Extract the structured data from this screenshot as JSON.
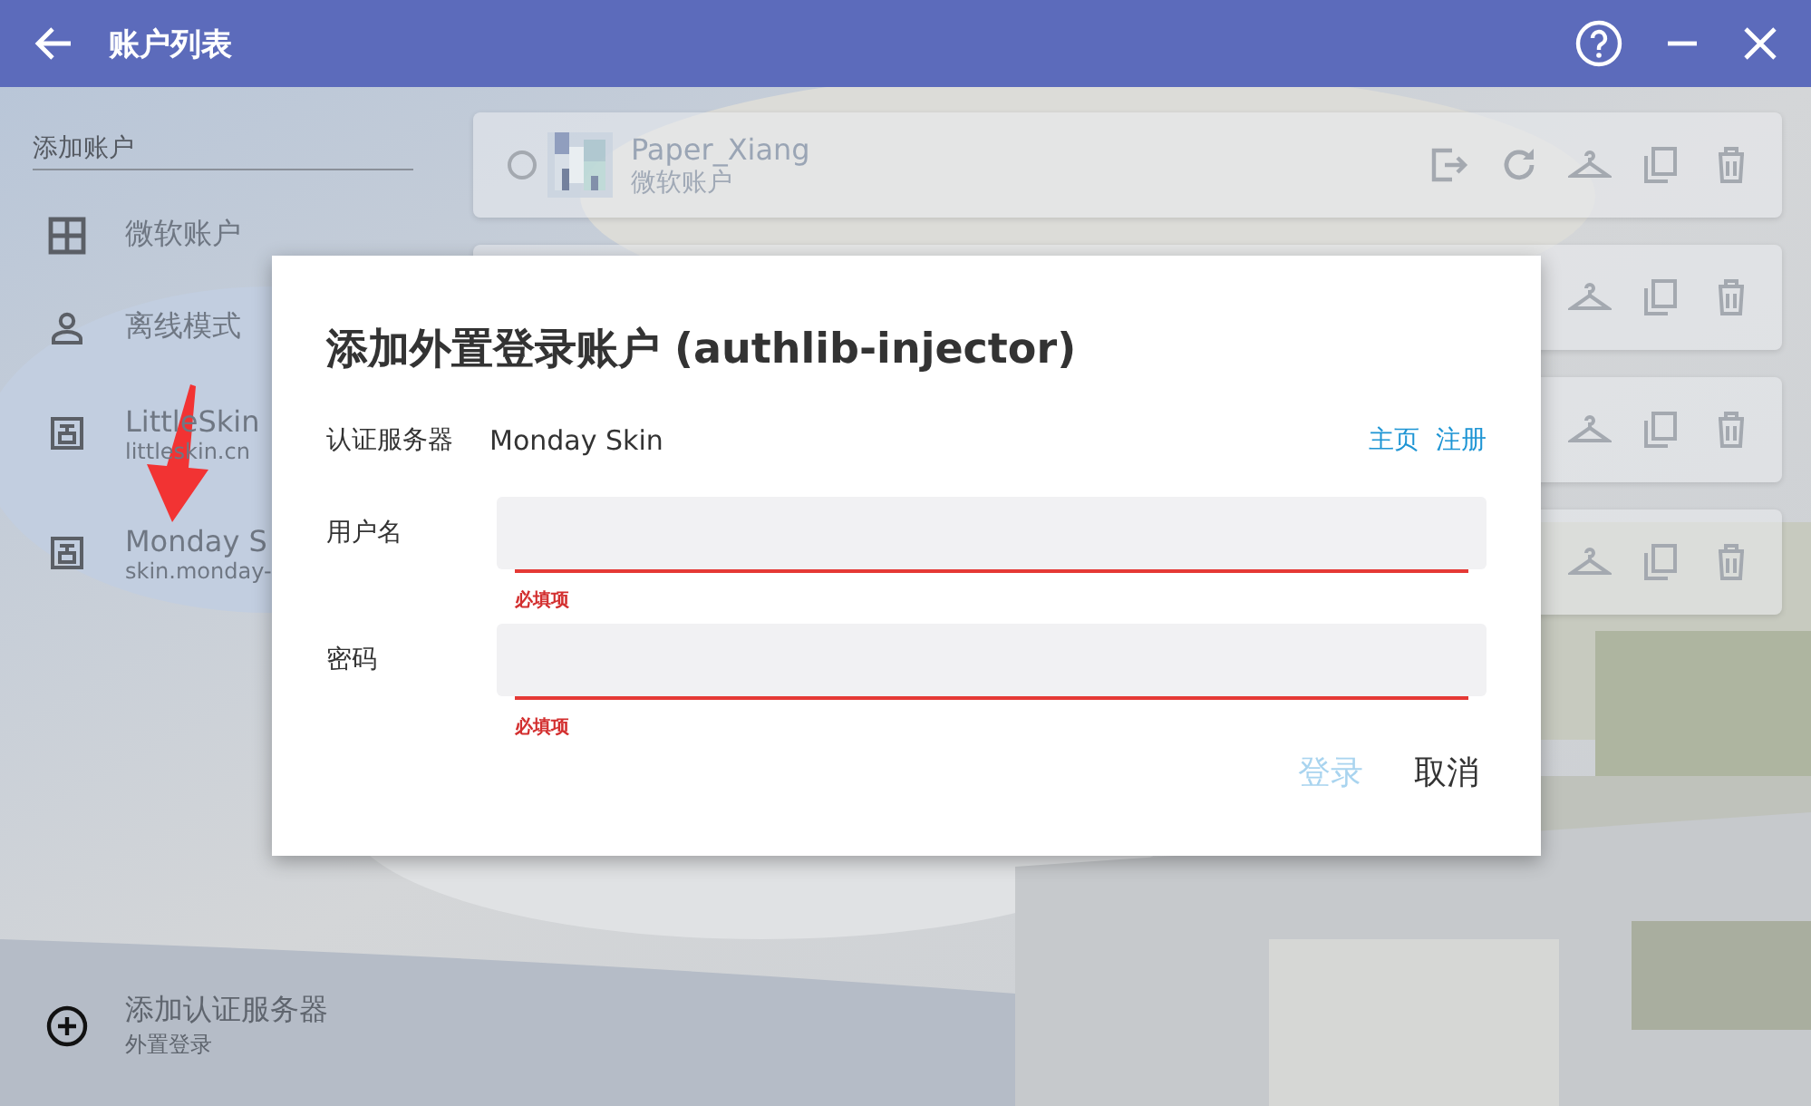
{
  "title_bar": {
    "title": "账户列表"
  },
  "sidebar": {
    "section_label": "添加账户",
    "items": [
      {
        "kind": "microsoft",
        "label": "微软账户"
      },
      {
        "kind": "offline",
        "label": "离线模式"
      },
      {
        "kind": "server",
        "label": "LittleSkin",
        "sublabel": "littleskin.cn"
      },
      {
        "kind": "server",
        "label": "Monday S",
        "sublabel": "skin.monday-"
      }
    ],
    "add_server": {
      "label": "添加认证服务器",
      "sublabel": "外置登录"
    }
  },
  "accounts": [
    {
      "kind": "full",
      "name": "Paper_Xiang",
      "type": "微软账户",
      "selected": false
    },
    {
      "kind": "covered"
    },
    {
      "kind": "covered"
    },
    {
      "kind": "covered"
    }
  ],
  "dialog": {
    "title": "添加外置登录账户 (authlib-injector)",
    "server_label": "认证服务器",
    "server_value": "Monday Skin",
    "links": [
      "主页",
      "注册"
    ],
    "fields": [
      {
        "label": "用户名",
        "error": "必填项"
      },
      {
        "label": "密码",
        "error": "必填项"
      }
    ],
    "buttons": [
      {
        "label": "登录",
        "disabled": true
      },
      {
        "label": "取消",
        "disabled": false
      }
    ]
  }
}
